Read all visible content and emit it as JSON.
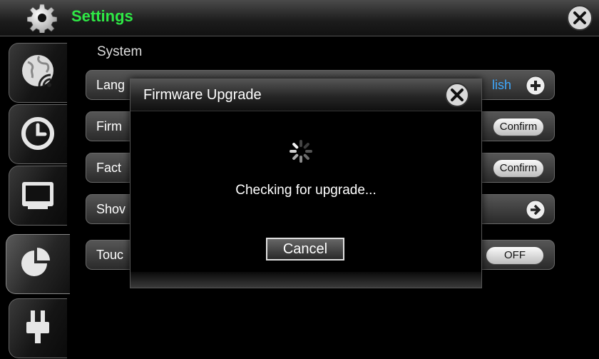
{
  "window": {
    "title": "Settings"
  },
  "sidebar": {
    "items": [
      {
        "icon": "globe-wifi-icon"
      },
      {
        "icon": "clock-icon"
      },
      {
        "icon": "display-icon"
      },
      {
        "icon": "pie-chart-icon"
      },
      {
        "icon": "power-plug-icon"
      }
    ],
    "active_index": 3
  },
  "settings": {
    "section_title": "System",
    "rows": [
      {
        "label": "Lang",
        "value": "lish",
        "action": "plus-icon"
      },
      {
        "label": "Firm",
        "button": "Confirm"
      },
      {
        "label": "Fact",
        "button": "Confirm"
      },
      {
        "label": "Shov",
        "action": "arrow-right-icon"
      },
      {
        "label": "Touc",
        "toggle": "OFF"
      }
    ]
  },
  "dialog": {
    "title": "Firmware Upgrade",
    "message": "Checking for upgrade...",
    "cancel_label": "Cancel"
  },
  "colors": {
    "title_green": "#2ee845",
    "value_blue": "#3fa9ff"
  }
}
